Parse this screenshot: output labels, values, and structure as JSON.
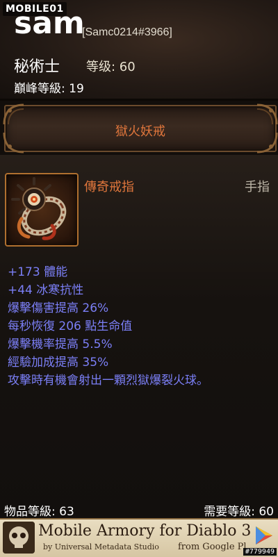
{
  "watermark": {
    "text": "MOBILE01"
  },
  "hero": {
    "name": "sam",
    "battletag": "[Samc0214#3966]",
    "class": "秘術士",
    "level": "等级: 60",
    "paragon": "巔峰等級: 19"
  },
  "item": {
    "name": "獄火妖戒",
    "rarity": "傳奇戒指",
    "slot": "手指",
    "icon": "ring-icon",
    "stats": [
      "+173 體能",
      "+44 冰寒抗性",
      "爆擊傷害提高 26%",
      "每秒恢復 206 點生命值",
      "爆擊機率提高 5.5%",
      "經驗加成提高 35%",
      "攻擊時有機會射出一顆烈獄爆裂火球。"
    ],
    "item_level": "物品等級: 63",
    "required_level": "需要等級: 60"
  },
  "ad": {
    "title": "Mobile Armory for Diablo 3",
    "subtitle": "by Universal Metadata Studio",
    "store": "from Google Pl",
    "id": "#779949"
  },
  "colors": {
    "legendary": "#e0763c",
    "magic_affix": "#7b7ff6",
    "frame_gold": "#b0702f"
  }
}
